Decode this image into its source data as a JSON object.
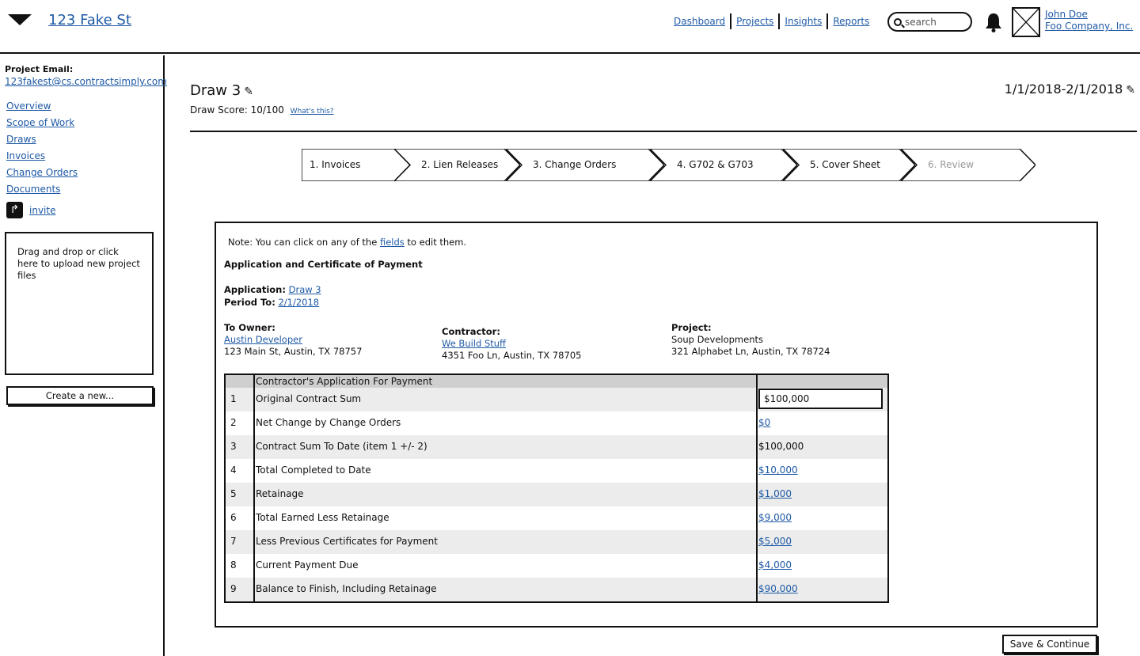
{
  "header": {
    "address": "123 Fake St",
    "nav": [
      "Dashboard",
      "Projects",
      "Insights",
      "Reports"
    ],
    "search_placeholder": "search",
    "user_name": "John Doe",
    "company": "Foo Company, Inc."
  },
  "sidebar": {
    "email_label": "Project Email:",
    "email": "123fakest@cs.contractsimply.com",
    "items": [
      "Overview",
      "Scope of Work",
      "Draws",
      "Invoices",
      "Change Orders",
      "Documents"
    ],
    "invite": "invite",
    "upload_text": "Drag and drop or click here to upload new project files",
    "create": "Create a new..."
  },
  "draw": {
    "title": "Draw 3",
    "score": "Draw Score: 10/100",
    "whats_this": "What's this?",
    "date_range": "1/1/2018-2/1/2018"
  },
  "steps": [
    {
      "label": "1. Invoices",
      "active": true
    },
    {
      "label": "2. Lien Releases",
      "active": true
    },
    {
      "label": "3. Change Orders",
      "active": true
    },
    {
      "label": "4. G702 & G703",
      "active": true
    },
    {
      "label": "5. Cover Sheet",
      "active": true
    },
    {
      "label": "6. Review",
      "active": false
    }
  ],
  "form": {
    "note_prefix": "Note: You can click on any of the",
    "note_link": "fields",
    "note_suffix": "to edit them.",
    "heading": "Application and Certificate of Payment",
    "application_label": "Application:",
    "application_value": "Draw 3",
    "period_label": "Period To:",
    "period_value": "2/1/2018",
    "owner": {
      "label": "To Owner:",
      "name": "Austin Developer",
      "address": "123 Main St, Austin, TX 78757"
    },
    "contractor": {
      "label": "Contractor:",
      "name": "We Build Stuff",
      "address": "4351 Foo Ln, Austin, TX 78705"
    },
    "project": {
      "label": "Project:",
      "name": "Soup Developments",
      "address": "321 Alphabet Ln, Austin, TX 78724"
    }
  },
  "table": {
    "header": "Contractor's Application For Payment",
    "rows": [
      {
        "num": "1",
        "label": "Original Contract Sum",
        "value": "$100,000",
        "kind": "input"
      },
      {
        "num": "2",
        "label": "Net Change by Change Orders",
        "value": "$0",
        "kind": "link"
      },
      {
        "num": "3",
        "label": "Contract Sum To Date (item 1 +/- 2)",
        "value": "$100,000",
        "kind": "text"
      },
      {
        "num": "4",
        "label": "Total Completed to Date",
        "value": "$10,000",
        "kind": "link"
      },
      {
        "num": "5",
        "label": "Retainage",
        "value": "$1,000",
        "kind": "link"
      },
      {
        "num": "6",
        "label": "Total Earned Less Retainage",
        "value": "$9,000",
        "kind": "link"
      },
      {
        "num": "7",
        "label": "Less Previous Certificates for Payment",
        "value": "$5,000",
        "kind": "link"
      },
      {
        "num": "8",
        "label": "Current Payment Due",
        "value": "$4,000",
        "kind": "link"
      },
      {
        "num": "9",
        "label": "Balance to Finish, Including Retainage",
        "value": "$90,000",
        "kind": "link"
      }
    ]
  },
  "save_button": "Save & Continue"
}
